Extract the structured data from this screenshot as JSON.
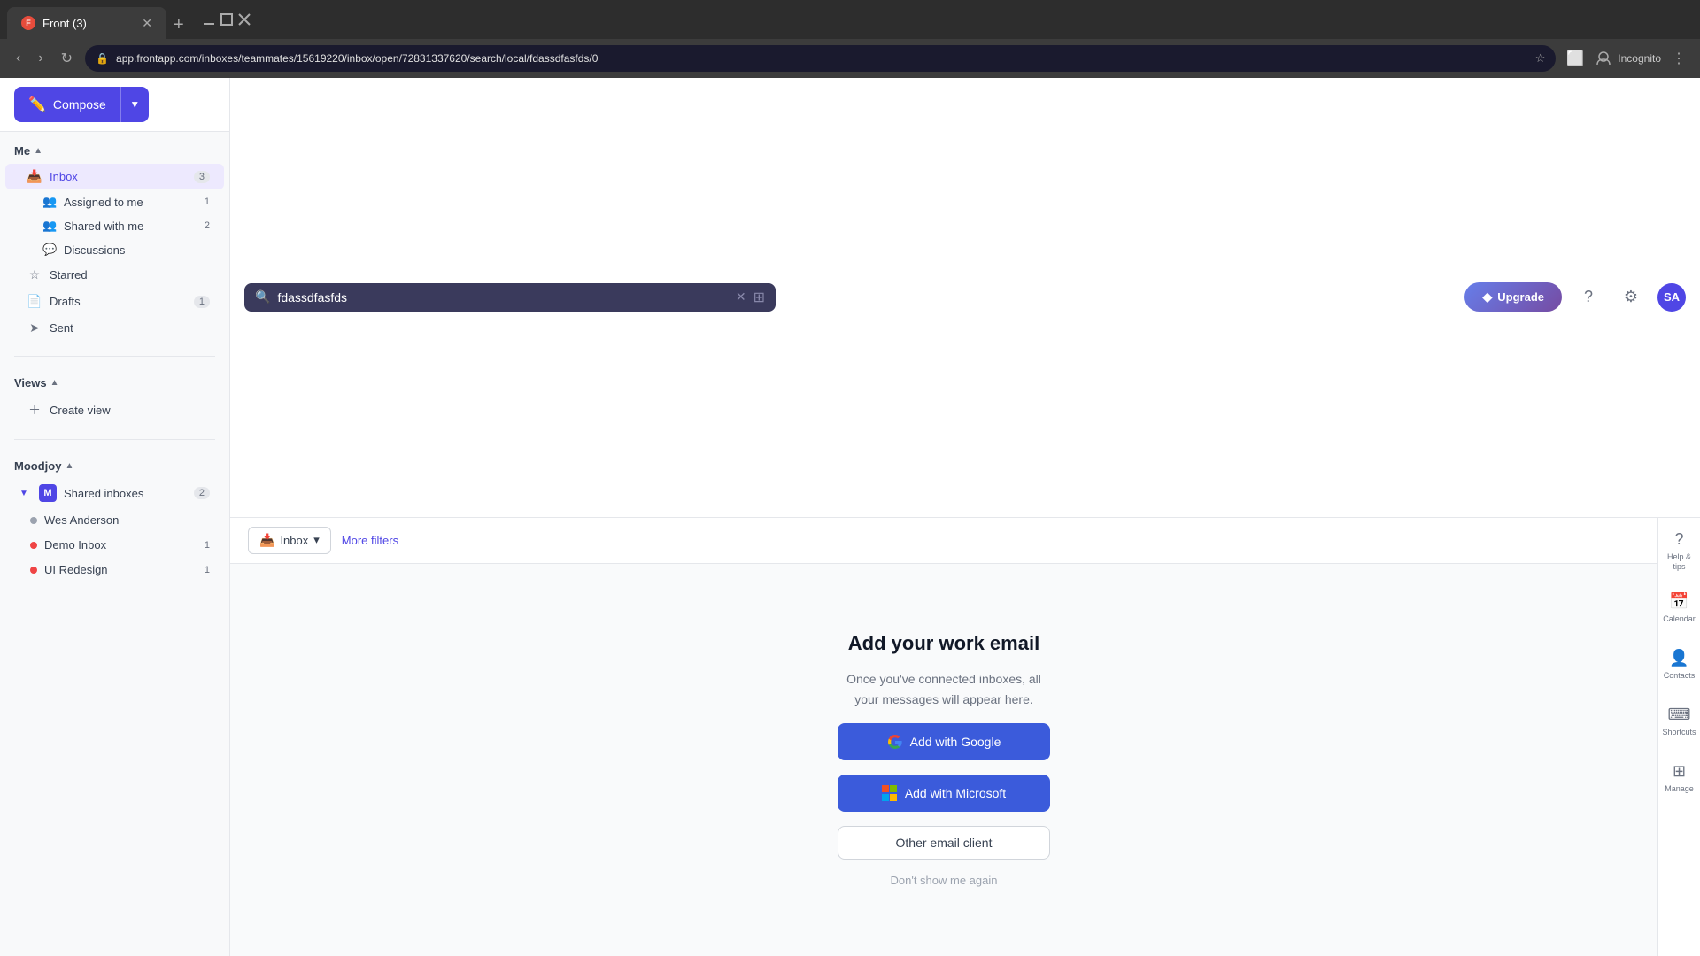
{
  "browser": {
    "tab_title": "Front (3)",
    "tab_favicon": "F",
    "url": "app.frontapp.com/inboxes/teammates/15619220/inbox/open/72831337620/search/local/fdassdfasfds/0",
    "new_tab_label": "+",
    "back_btn": "←",
    "forward_btn": "→",
    "refresh_btn": "↻",
    "incognito_label": "Incognito"
  },
  "topbar": {
    "compose_label": "Compose",
    "search_placeholder": "fdassdfasfds",
    "search_value": "fdassdfasfds",
    "upgrade_label": "Upgrade",
    "help_label": "?",
    "settings_label": "⚙",
    "avatar_label": "SA"
  },
  "sidebar": {
    "me_section": "Me",
    "inbox_label": "Inbox",
    "inbox_count": "3",
    "assigned_to_me_label": "Assigned to me",
    "assigned_to_me_count": "1",
    "shared_with_me_label": "Shared with me",
    "shared_with_me_count": "2",
    "discussions_label": "Discussions",
    "starred_label": "Starred",
    "drafts_label": "Drafts",
    "drafts_count": "1",
    "sent_label": "Sent",
    "views_section": "Views",
    "create_view_label": "Create view",
    "moodjoy_section": "Moodjoy",
    "shared_inboxes_label": "Shared inboxes",
    "shared_inboxes_count": "2",
    "inbox_wes": "Wes Anderson",
    "inbox_demo": "Demo Inbox",
    "inbox_demo_count": "1",
    "inbox_ui": "UI Redesign",
    "inbox_ui_count": "1"
  },
  "filter_bar": {
    "inbox_filter_label": "Inbox",
    "more_filters_label": "More filters"
  },
  "empty_state": {
    "title": "Add your work email",
    "subtitle_line1": "Once you've connected inboxes, all",
    "subtitle_line2": "your messages will appear here.",
    "add_google_label": "Add with Google",
    "add_microsoft_label": "Add with Microsoft",
    "other_email_label": "Other email client",
    "dont_show_label": "Don't show me again"
  },
  "right_panel": {
    "help_label": "Help & tips",
    "calendar_label": "Calendar",
    "contacts_label": "Contacts",
    "shortcuts_label": "Shortcuts",
    "manage_label": "Manage"
  }
}
